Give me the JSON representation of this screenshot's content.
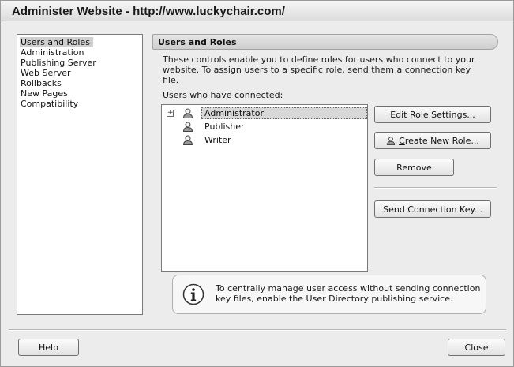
{
  "window": {
    "title": "Administer Website - http://www.luckychair.com/"
  },
  "nav": {
    "items": [
      {
        "label": "Users and Roles",
        "selected": true
      },
      {
        "label": "Administration",
        "selected": false
      },
      {
        "label": "Publishing Server",
        "selected": false
      },
      {
        "label": "Web Server",
        "selected": false
      },
      {
        "label": "Rollbacks",
        "selected": false
      },
      {
        "label": "New Pages",
        "selected": false
      },
      {
        "label": "Compatibility",
        "selected": false
      }
    ]
  },
  "panel": {
    "header": "Users and Roles",
    "description": "These controls enable you to define roles for users who connect to your website. To assign users to a specific role, send them a connection key file.",
    "users_label": "Users who have connected:",
    "users": [
      {
        "name": "Administrator",
        "expander": "+",
        "selected": true,
        "icon": "user-icon"
      },
      {
        "name": "Publisher",
        "selected": false,
        "icon": "user-icon"
      },
      {
        "name": "Writer",
        "selected": false,
        "icon": "user-icon"
      }
    ]
  },
  "buttons": {
    "edit_role": "Edit Role Settings...",
    "create_role_pre": "",
    "create_role_u": "C",
    "create_role_post": "reate New Role...",
    "remove": "Remove",
    "send_key": "Send Connection Key...",
    "help": "Help",
    "close": "Close"
  },
  "info": {
    "icon": "info-icon",
    "text": "To centrally manage user access without sending connection key files, enable the User Directory publishing service."
  }
}
